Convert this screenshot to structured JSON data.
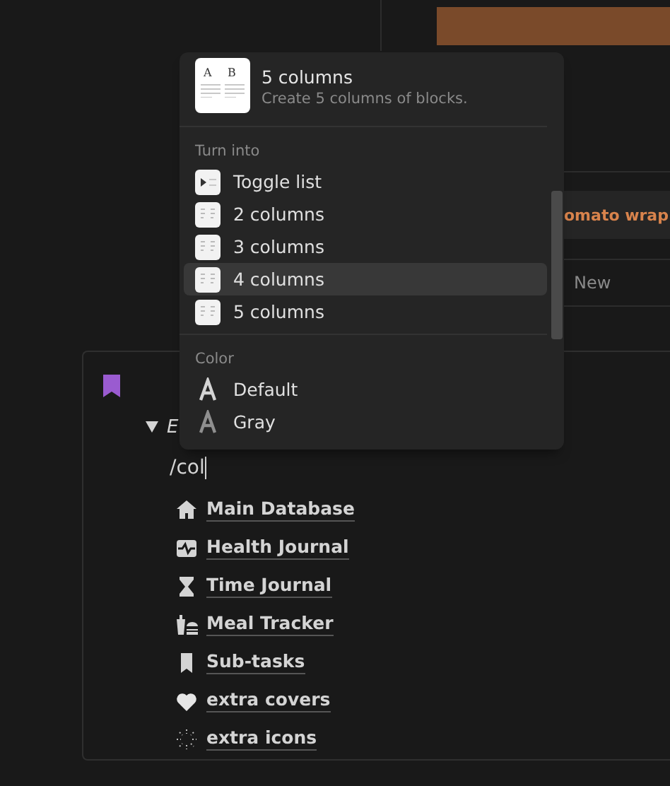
{
  "board": {
    "card_title": "omato wrap",
    "new_label": "New"
  },
  "page": {
    "toggle": {
      "expanded": true,
      "title": "E"
    },
    "input": {
      "value": "/col"
    },
    "links": [
      {
        "label": "Main Database",
        "kind": "house"
      },
      {
        "label": "Health Journal",
        "kind": "pulse"
      },
      {
        "label": "Time Journal",
        "kind": "hourglass"
      },
      {
        "label": "Meal Tracker",
        "kind": "meal"
      },
      {
        "label": "Sub-tasks",
        "kind": "bookmark"
      },
      {
        "label": "extra covers",
        "kind": "heart"
      },
      {
        "label": "extra icons",
        "kind": "sparkle"
      }
    ]
  },
  "menu": {
    "preview": {
      "letters": [
        "A",
        "B"
      ],
      "title": "5 columns",
      "description": "Create 5 columns of blocks."
    },
    "sections": [
      {
        "heading": "Turn into",
        "items": [
          {
            "label": "Toggle list",
            "kind": "toggle",
            "selected": false
          },
          {
            "label": "2 columns",
            "kind": "columns",
            "selected": false
          },
          {
            "label": "3 columns",
            "kind": "columns",
            "selected": false
          },
          {
            "label": "4 columns",
            "kind": "columns",
            "selected": true
          },
          {
            "label": "5 columns",
            "kind": "columns",
            "selected": false
          }
        ]
      },
      {
        "heading": "Color",
        "items": [
          {
            "label": "Default",
            "kind": "color",
            "color": "#d4d4d4",
            "selected": false
          },
          {
            "label": "Gray",
            "kind": "color",
            "color": "#8f8f8f",
            "selected": false
          }
        ]
      }
    ]
  }
}
